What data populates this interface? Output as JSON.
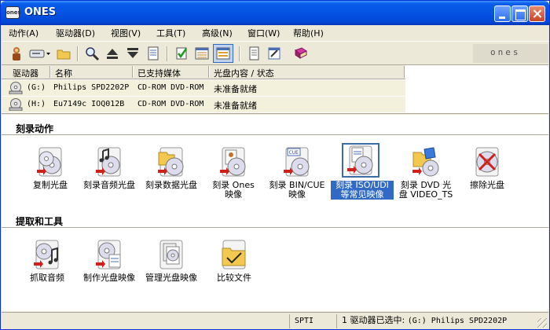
{
  "window": {
    "title": "ONES",
    "app_icon_text": "ones"
  },
  "menu": [
    {
      "label": "动作(A)"
    },
    {
      "label": "驱动器(D)"
    },
    {
      "label": "视图(V)"
    },
    {
      "label": "工具(T)"
    },
    {
      "label": "高级(N)"
    },
    {
      "label": "窗口(W)"
    },
    {
      "label": "帮助(H)"
    }
  ],
  "toolbar": {
    "icons": [
      "ones-icon",
      "drive-select-icon",
      "folder-icon",
      "search-icon",
      "eject-icon",
      "load-icon",
      "log-icon",
      "check-icon",
      "list-view-icon",
      "detail-view-icon",
      "document-icon",
      "edit-icon",
      "book-icon"
    ],
    "brand_text": "ones"
  },
  "drives": {
    "headers": [
      "驱动器",
      "名称",
      "已支持媒体",
      "光盘内容 / 状态"
    ],
    "rows": [
      {
        "letter": "(G:)",
        "name": "Philips SPD2202P",
        "media": "CD-ROM DVD-ROM",
        "status": "未准备就绪"
      },
      {
        "letter": "(H:)",
        "name": "Eu7149c IOQ012B",
        "media": "CD-ROM DVD-ROM",
        "status": "未准备就绪"
      }
    ]
  },
  "burn_section": {
    "title": "刻录动作",
    "items": [
      {
        "label": "复制光盘",
        "icon": "copy-disc-icon"
      },
      {
        "label": "刻录音频光盘",
        "icon": "audio-disc-icon"
      },
      {
        "label": "刻录数据光盘",
        "icon": "data-disc-icon"
      },
      {
        "label": "刻录 Ones\n映像",
        "icon": "ones-image-icon"
      },
      {
        "label": "刻录 BIN/CUE\n映像",
        "icon": "bin-cue-icon"
      },
      {
        "label": "刻录 ISO/UDI\n等常见映像",
        "icon": "iso-image-icon",
        "selected": true
      },
      {
        "label": "刻录 DVD 光\n盘 VIDEO_TS",
        "icon": "dvd-video-icon"
      },
      {
        "label": "擦除光盘",
        "icon": "erase-disc-icon"
      }
    ]
  },
  "extract_section": {
    "title": "提取和工具",
    "items": [
      {
        "label": "抓取音频",
        "icon": "rip-audio-icon"
      },
      {
        "label": "制作光盘映像",
        "icon": "make-image-icon"
      },
      {
        "label": "管理光盘映像",
        "icon": "manage-images-icon"
      },
      {
        "label": "比较文件",
        "icon": "compare-files-icon"
      }
    ]
  },
  "statusbar": {
    "interface": "SPTI",
    "selection_prefix": "1 驱动器已选中:",
    "selection_drive": "(G:) Philips SPD2202P"
  }
}
